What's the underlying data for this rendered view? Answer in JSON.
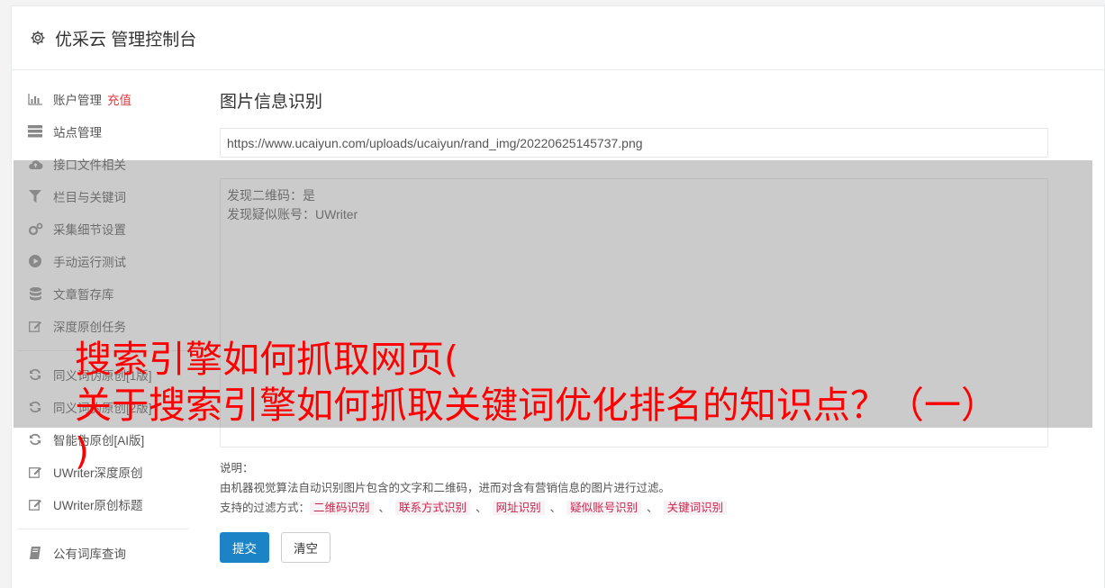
{
  "header": {
    "title": "优采云 管理控制台"
  },
  "sidebar": {
    "items": [
      {
        "label": "账户管理",
        "extra": "充值",
        "icon": "bar-chart-icon"
      },
      {
        "label": "站点管理",
        "icon": "server-icon"
      },
      {
        "label": "接口文件相关",
        "icon": "cloud-upload-icon"
      },
      {
        "label": "栏目与关键词",
        "icon": "filter-icon"
      },
      {
        "label": "采集细节设置",
        "icon": "cogs-icon"
      },
      {
        "label": "手动运行测试",
        "icon": "play-circle-icon"
      },
      {
        "label": "文章暂存库",
        "icon": "database-icon"
      },
      {
        "label": "深度原创任务",
        "icon": "edit-icon"
      }
    ],
    "items2": [
      {
        "label": "同义词伪原创[1版]",
        "icon": "refresh-icon"
      },
      {
        "label": "同义词伪原创[2版]",
        "icon": "refresh-icon"
      },
      {
        "label": "智能伪原创[AI版]",
        "icon": "refresh-icon"
      },
      {
        "label": "UWriter深度原创",
        "icon": "edit-icon"
      },
      {
        "label": "UWriter原创标题",
        "icon": "edit-icon"
      }
    ],
    "items3": [
      {
        "label": "公有词库查询",
        "icon": "book-icon"
      }
    ]
  },
  "main": {
    "section_title": "图片信息识别",
    "url_value": "https://www.ucaiyun.com/uploads/ucaiyun/rand_img/20220625145737.png",
    "result_lines": [
      "发现二维码：是",
      "发现疑似账号：UWriter"
    ],
    "desc_label": "说明：",
    "desc_text": "由机器视觉算法自动识别图片包含的文字和二维码，进而对含有营销信息的图片进行过滤。",
    "filter_label": "支持的过滤方式：",
    "filter_tags": [
      "二维码识别",
      "联系方式识别",
      "网址识别",
      "疑似账号识别",
      "关键词识别"
    ],
    "submit_label": "提交",
    "clear_label": "清空"
  },
  "overlay": {
    "line1": "搜索引擎如何抓取网页(",
    "line2": "关于搜索引擎如何抓取关键词优化排名的知识点？（一）",
    "line3": ")"
  }
}
